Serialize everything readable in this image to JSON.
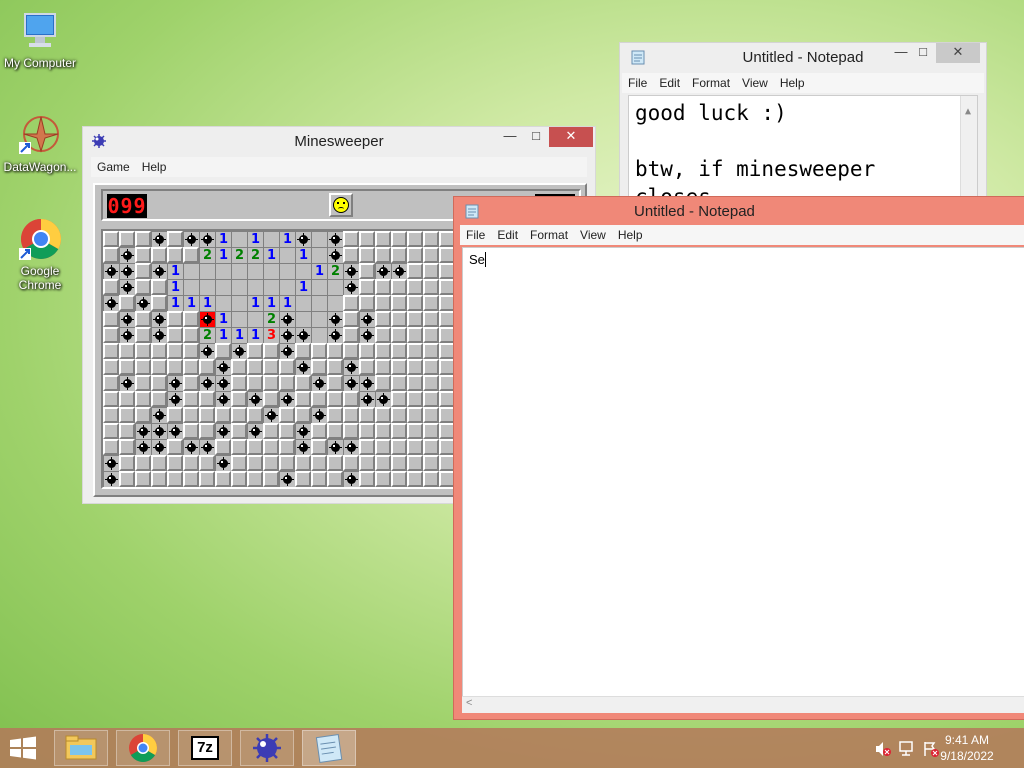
{
  "desktop": {
    "icons": [
      {
        "label": "My Computer",
        "icon": "computer-icon"
      },
      {
        "label": "DataWagon...",
        "icon": "datawagon-icon"
      },
      {
        "label": "Google Chrome",
        "icon": "chrome-icon"
      }
    ]
  },
  "minesweeper": {
    "title": "Minesweeper",
    "menu": [
      "Game",
      "Help"
    ],
    "mine_counter": "099",
    "timer": "",
    "face": "sad-face-icon",
    "rows": [
      "...M.MM1.1.1M.M.",
      ".M....21221.1.M.",
      "MM.M1........12M.MM.",
      ".M..1.......1..M",
      "M.M.111..111....",
      ".M.M..X1..2M..M.M",
      ".M.M..21113MM.M.M",
      "......M.M..M.....",
      ".......M....M..M.",
      ".M..M.MM.....M.MM",
      "....M..M.M.M....MM",
      "...M......M..M..",
      "..MMM..M.M..M...",
      "..MM.MM.....M.MM.",
      "M......M........",
      "M..........M...M"
    ]
  },
  "notepad_back": {
    "title": "Untitled - Notepad",
    "menu": [
      "File",
      "Edit",
      "Format",
      "View",
      "Help"
    ],
    "line1": "good luck :)",
    "line2": "",
    "line3": "btw, if minesweeper",
    "line4": "closes"
  },
  "notepad_front": {
    "title": "Untitled - Notepad",
    "menu": [
      "File",
      "Edit",
      "Format",
      "View",
      "Help"
    ],
    "text": "Se"
  },
  "taskbar": {
    "items": [
      "start-icon",
      "file-explorer-icon",
      "chrome-icon",
      "7zip-icon",
      "minesweeper-icon",
      "notepad-icon"
    ],
    "label_7z": "7z",
    "time": "9:41 AM",
    "date": "9/18/2022"
  }
}
